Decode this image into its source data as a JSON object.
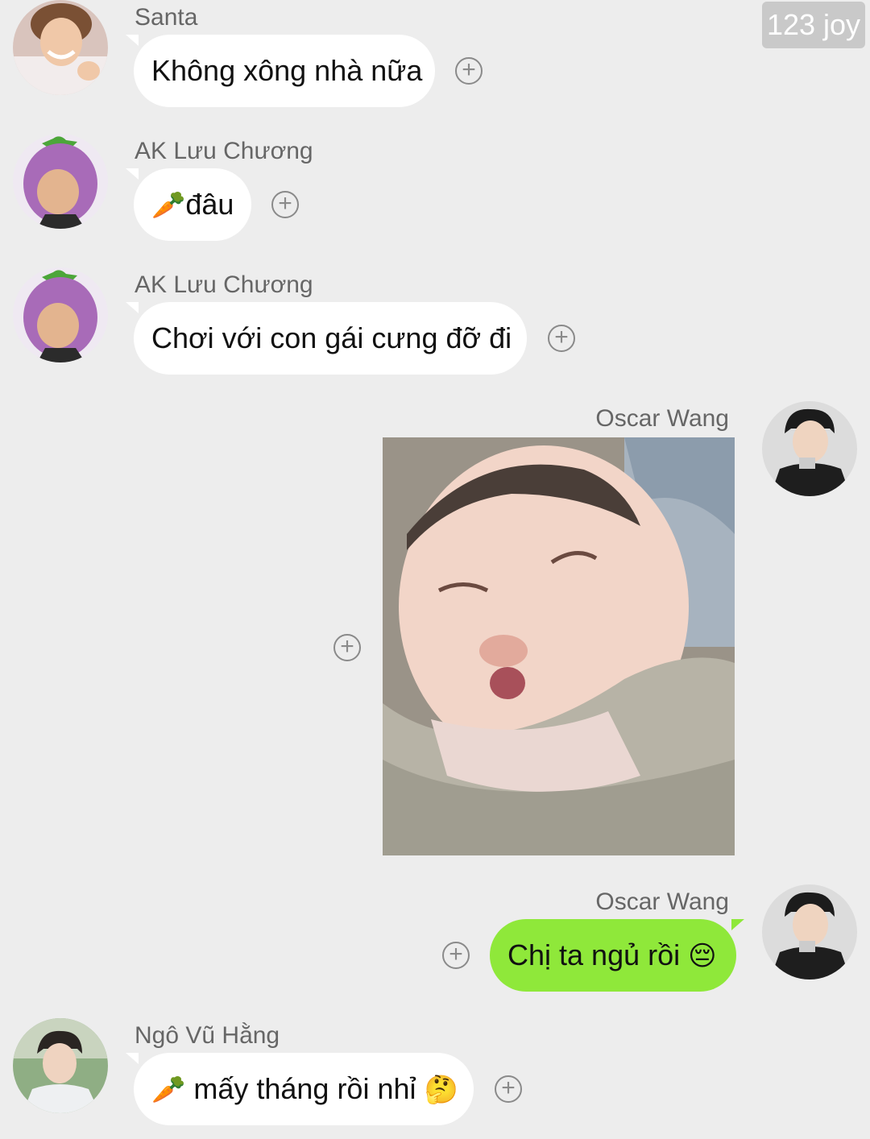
{
  "watermark": "123 joy",
  "messages": [
    {
      "sender": "Santa",
      "text": "Không xông nhà nữa"
    },
    {
      "sender": "AK Lưu Chương",
      "emoji": "🥕",
      "text": "đâu"
    },
    {
      "sender": "AK Lưu Chương",
      "text": "Chơi với con gái cưng đỡ đi"
    },
    {
      "sender": "Oscar Wang",
      "type": "image",
      "image_label": "sleeping-baby-photo"
    },
    {
      "sender": "Oscar Wang",
      "text": "Chị ta ngủ rồi",
      "emoji_end": "😔"
    },
    {
      "sender": "Ngô Vũ Hằng",
      "emoji": "🥕",
      "text": " mấy tháng rồi nhỉ",
      "emoji_end": "🤔"
    }
  ],
  "plus_symbol": "+",
  "colors": {
    "background": "#ededed",
    "incoming_bubble": "#ffffff",
    "outgoing_bubble": "#8fe83a",
    "sender_name": "#666666"
  }
}
